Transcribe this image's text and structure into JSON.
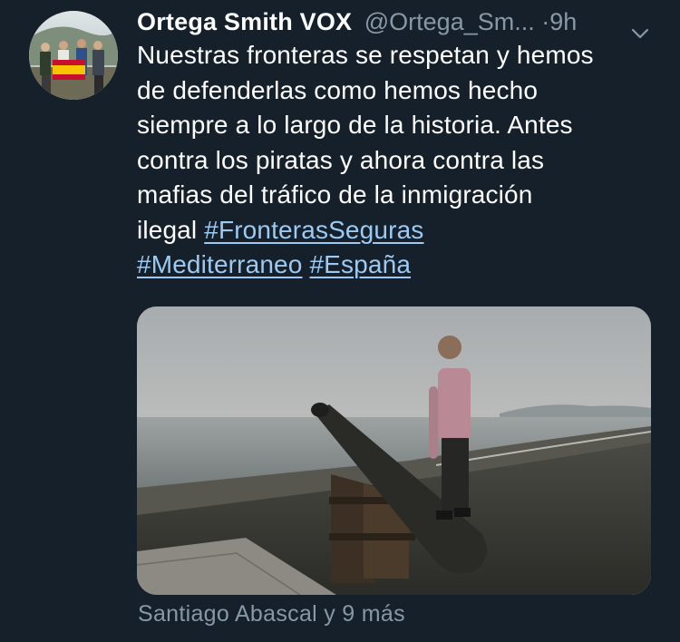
{
  "tweet": {
    "author_name": "Ortega Smith VOX",
    "author_handle": "@Ortega_Sm...",
    "separator": "·",
    "time": "9h",
    "text_lines": [
      "Nuestras fronteras se respetan y hemos",
      "de defenderlas como hemos hecho",
      "siempre a lo largo de la historia. Antes",
      "contra los piratas y ahora contra las",
      "mafias del tráfico de la inmigración"
    ],
    "text_last_prefix": "ilegal ",
    "hashtags": [
      "#FronterasSeguras",
      "#Mediterraneo",
      "#España"
    ],
    "engagement": "Santiago Abascal y 9 más"
  },
  "icons": {
    "avatar": "profile-photo",
    "menu": "chevron-down-icon",
    "media": "photo-man-with-cannon-by-sea"
  },
  "colors": {
    "background": "#15202b",
    "secondary_text": "#8899a6",
    "link": "#9ccaf2",
    "primary_text": "#ffffff"
  }
}
